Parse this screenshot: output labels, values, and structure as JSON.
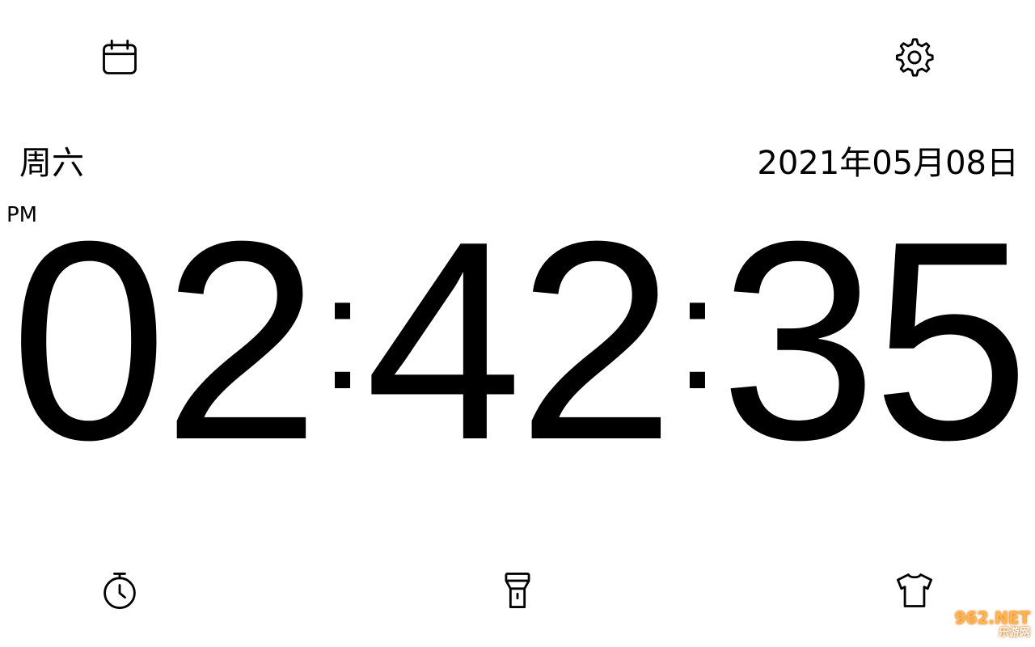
{
  "app": {
    "icons": {
      "calendar": "calendar-icon",
      "settings": "gear-icon",
      "timer": "stopwatch-icon",
      "flashlight": "flashlight-icon",
      "theme": "tshirt-icon"
    }
  },
  "date_info": {
    "weekday": "周六",
    "date": "2021年05月08日",
    "ampm": "PM"
  },
  "clock": {
    "hours": "02",
    "minutes": "42",
    "seconds": "35",
    "separator": ":"
  },
  "watermark": {
    "line1": "962.NET",
    "line2": "乐游网"
  },
  "colors": {
    "background": "#ffffff",
    "text": "#000000"
  }
}
